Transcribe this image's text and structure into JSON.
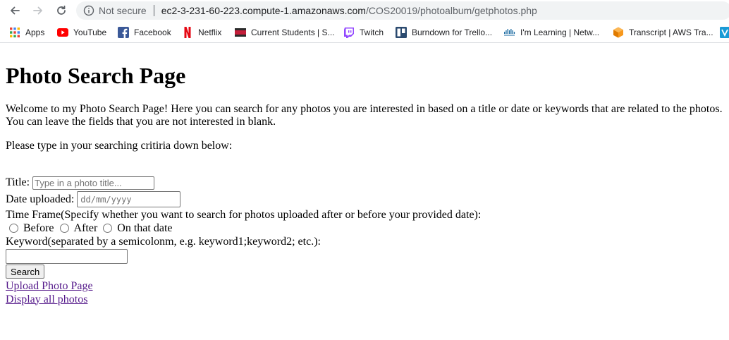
{
  "browser": {
    "security_label": "Not secure",
    "url_host": "ec2-3-231-60-223.compute-1.amazonaws.com",
    "url_path": "/COS20019/photoalbum/getphotos.php",
    "bookmarks": [
      {
        "label": "Apps",
        "icon": "apps-grid-icon"
      },
      {
        "label": "YouTube",
        "icon": "youtube-icon"
      },
      {
        "label": "Facebook",
        "icon": "facebook-icon"
      },
      {
        "label": "Netflix",
        "icon": "netflix-icon"
      },
      {
        "label": "Current Students | S...",
        "icon": "flag-icon"
      },
      {
        "label": "Twitch",
        "icon": "twitch-icon"
      },
      {
        "label": "Burndown for Trello...",
        "icon": "burndown-icon"
      },
      {
        "label": "I'm Learning | Netw...",
        "icon": "cisco-icon"
      },
      {
        "label": "Transcript | AWS Tra...",
        "icon": "aws-cube-icon"
      }
    ]
  },
  "page": {
    "title": "Photo Search Page",
    "intro_line1": "Welcome to my Photo Search Page! Here you can search for any photos you are interested in based on a title or date or keywords that are related to the photos.",
    "intro_line2": "You can leave the fields that you are not interested in blank.",
    "prompt": "Please type in your searching critiria down below:",
    "form": {
      "title_label": "Title:",
      "title_placeholder": "Type in a photo title...",
      "date_label": "Date uploaded:",
      "date_placeholder": "dd/mm/yyyy",
      "timeframe_label": "Time Frame(Specify whether you want to search for photos uploaded after or before your provided date):",
      "options": [
        "Before",
        "After",
        "On that date"
      ],
      "keyword_label": "Keyword(separated by a semicolonm, e.g. keyword1;keyword2; etc.):",
      "search_button": "Search"
    },
    "links": {
      "upload": "Upload Photo Page",
      "display_all": "Display all photos"
    }
  }
}
